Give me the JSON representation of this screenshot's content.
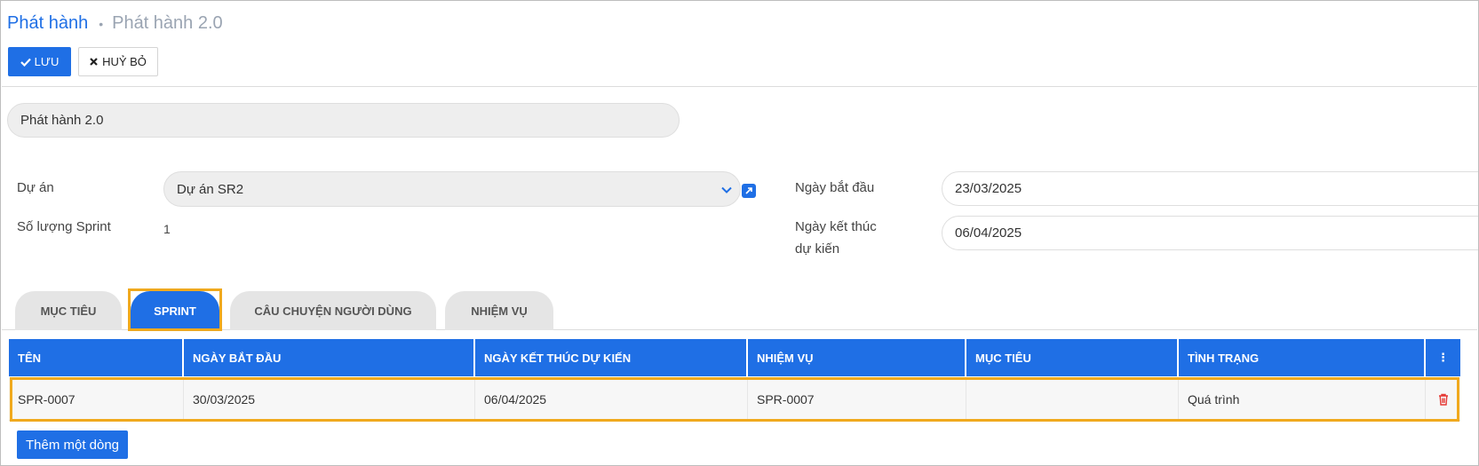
{
  "breadcrumb": {
    "parent": "Phát hành",
    "separator": "•",
    "current": "Phát hành 2.0"
  },
  "toolbar": {
    "save_icon": "check-icon",
    "save_label": "LƯU",
    "cancel_icon": "times-icon",
    "cancel_label": "HUỶ BỎ"
  },
  "form": {
    "name_value": "Phát hành 2.0",
    "project_label": "Dự án",
    "project_value": "Dự án SR2",
    "sprint_count_label": "Số lượng Sprint",
    "sprint_count_value": "1",
    "start_date_label": "Ngày bắt đầu",
    "start_date_value": "23/03/2025",
    "end_date_label_line1": "Ngày kết thúc",
    "end_date_label_line2": "dự kiến",
    "end_date_value": "06/04/2025"
  },
  "tabs": [
    {
      "label": "MỤC TIÊU",
      "active": false
    },
    {
      "label": "SPRINT",
      "active": true
    },
    {
      "label": "CÂU CHUYỆN NGƯỜI DÙNG",
      "active": false
    },
    {
      "label": "NHIỆM VỤ",
      "active": false
    }
  ],
  "table": {
    "columns": [
      "TÊN",
      "NGÀY BẮT ĐẦU",
      "NGÀY KẾT THÚC DỰ KIẾN",
      "NHIỆM VỤ",
      "MỤC TIÊU",
      "TÌNH TRẠNG",
      "⋮"
    ],
    "rows": [
      [
        "SPR-0007",
        "30/03/2025",
        "06/04/2025",
        "SPR-0007",
        "",
        "Quá trình"
      ]
    ],
    "add_row_label": "Thêm một dòng"
  },
  "colors": {
    "accent": "#1f6fe5",
    "highlight": "#f0a91e",
    "danger": "#e53935"
  }
}
